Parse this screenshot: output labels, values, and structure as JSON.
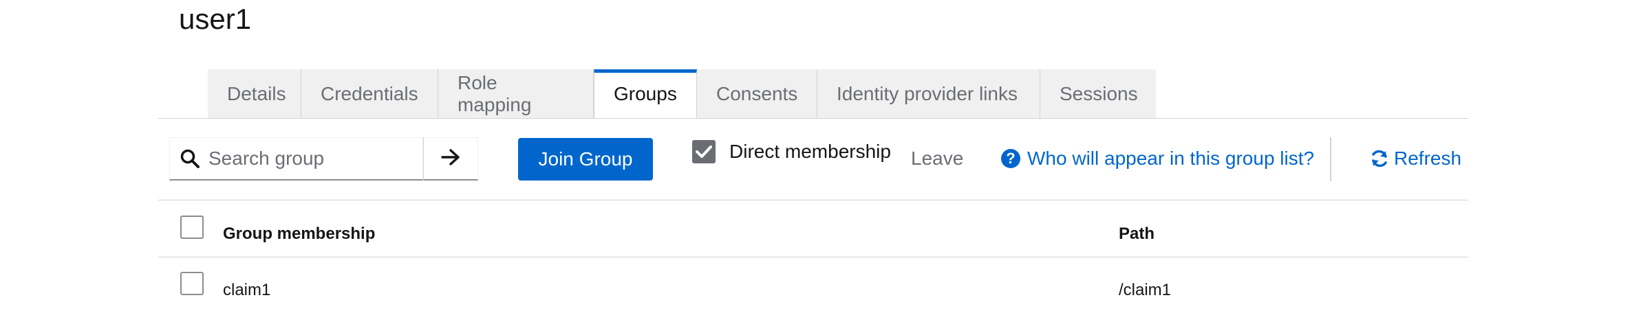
{
  "page": {
    "title": "user1"
  },
  "tabs": [
    {
      "label": "Details",
      "active": false
    },
    {
      "label": "Credentials",
      "active": false
    },
    {
      "label": "Role mapping",
      "active": false
    },
    {
      "label": "Groups",
      "active": true
    },
    {
      "label": "Consents",
      "active": false
    },
    {
      "label": "Identity provider links",
      "active": false
    },
    {
      "label": "Sessions",
      "active": false
    }
  ],
  "toolbar": {
    "search_placeholder": "Search group",
    "join_label": "Join Group",
    "direct_membership_label": "Direct membership",
    "direct_membership_checked": true,
    "leave_label": "Leave",
    "help_label": "Who will appear in this group list?",
    "refresh_label": "Refresh"
  },
  "table": {
    "columns": [
      "Group membership",
      "Path"
    ],
    "rows": [
      {
        "name": "claim1",
        "path": "/claim1"
      }
    ]
  },
  "colors": {
    "accent": "#0066cc",
    "muted": "#6a6e73",
    "border": "#d2d2d2"
  },
  "icons": {
    "search": "search-icon",
    "go": "arrow-right-icon",
    "help": "question-circle-icon",
    "refresh": "sync-icon",
    "check": "check-icon"
  }
}
